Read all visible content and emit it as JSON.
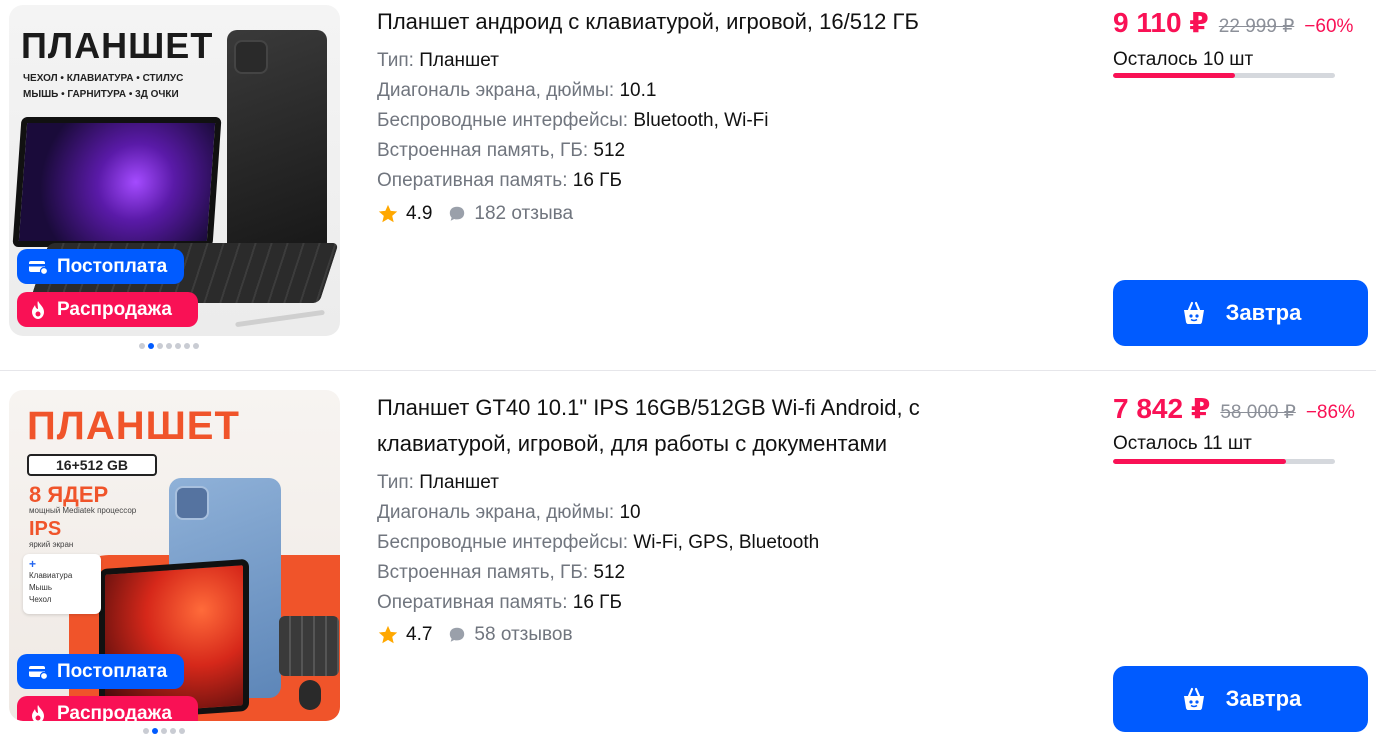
{
  "products": [
    {
      "image": {
        "headline": "ПЛАНШЕТ",
        "features_line1": "ЧЕХОЛ  •  КЛАВИАТУРА  •  СТИЛУС",
        "features_line2": "МЫШЬ  •  ГАРНИТУРА  •  3Д ОЧКИ"
      },
      "badges": {
        "postpay": "Постоплата",
        "sale": "Распродажа"
      },
      "carousel": {
        "total": 7,
        "active": 1
      },
      "title": "Планшет андроид с клавиатурой, игровой, 16/512 ГБ",
      "attrs": [
        {
          "k": "Тип: ",
          "v": "Планшет"
        },
        {
          "k": "Диагональ экрана, дюймы: ",
          "v": "10.1"
        },
        {
          "k": "Беспроводные интерфейсы: ",
          "v": "Bluetooth, Wi-Fi"
        },
        {
          "k": "Встроенная память, ГБ: ",
          "v": "512"
        },
        {
          "k": "Оперативная память: ",
          "v": "16 ГБ"
        }
      ],
      "rating": "4.9",
      "reviews": "182 отзыва",
      "price": "9 110 ₽",
      "old_price": "22 999 ₽",
      "discount": "−60%",
      "stock_text": "Осталось 10 шт",
      "stock_fill": 0.55,
      "buy_label": "Завтра"
    },
    {
      "image": {
        "headline": "ПЛАНШЕТ",
        "memory": "16+512 GB",
        "cores": "8 ЯДЕР",
        "cores_sub": "мощный Mediatek процессор",
        "ips": "IPS",
        "ips_sub": "яркий экран",
        "extras": [
          "Клавиатура",
          "Мышь",
          "Чехол"
        ]
      },
      "badges": {
        "postpay": "Постоплата",
        "sale": "Распродажа"
      },
      "carousel": {
        "total": 5,
        "active": 1
      },
      "title": "Планшет GT40 10.1\" IPS 16GB/512GB Wi-fi Android, с клавиатурой, игровой, для работы с документами",
      "attrs": [
        {
          "k": "Тип: ",
          "v": "Планшет"
        },
        {
          "k": "Диагональ экрана, дюймы: ",
          "v": "10"
        },
        {
          "k": "Беспроводные интерфейсы: ",
          "v": "Wi-Fi, GPS, Bluetooth"
        },
        {
          "k": "Встроенная память, ГБ: ",
          "v": "512"
        },
        {
          "k": "Оперативная память: ",
          "v": "16 ГБ"
        }
      ],
      "rating": "4.7",
      "reviews": "58 отзывов",
      "price": "7 842 ₽",
      "old_price": "58 000 ₽",
      "discount": "−86%",
      "stock_text": "Осталось 11 шт",
      "stock_fill": 0.78,
      "buy_label": "Завтра"
    }
  ],
  "colors": {
    "accent_blue": "#005bff",
    "sale_pink": "#f91155",
    "muted": "#70757e"
  },
  "icons": {
    "postpay": "card-icon",
    "sale": "flame-icon",
    "rating": "star-icon",
    "reviews": "chat-bubble-icon",
    "buy": "basket-icon"
  }
}
